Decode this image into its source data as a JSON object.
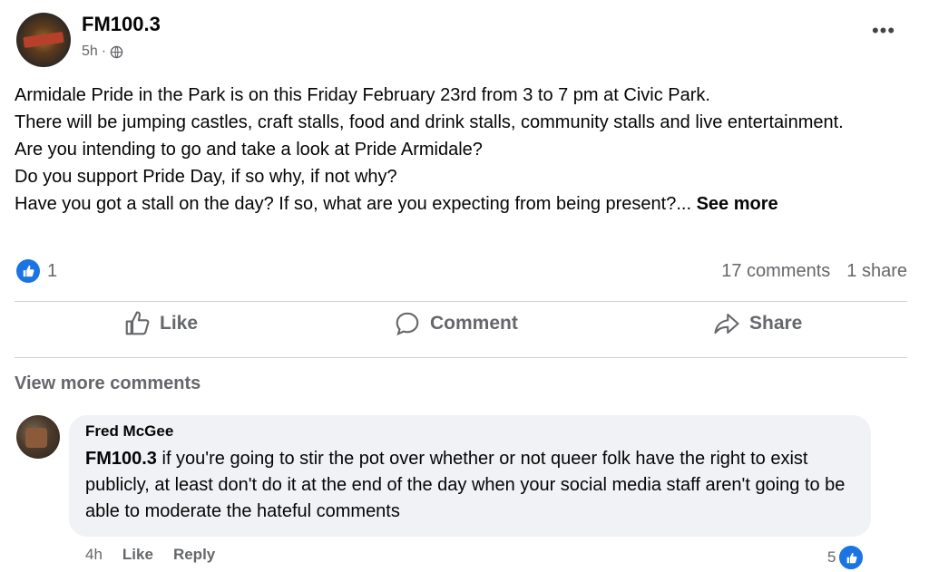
{
  "post": {
    "page_name": "FM100.3",
    "time": "5h",
    "dot": "·",
    "paragraphs": [
      "Armidale Pride in the Park is on this Friday February 23rd from 3 to 7 pm at Civic Park.",
      "There will be jumping castles, craft stalls, food and drink stalls, community stalls and live entertainment.",
      "Are you intending to go and take a look at Pride Armidale?",
      "Do you support Pride Day, if so why, if not why?",
      "Have you got a stall on the day? If so, what are you expecting from being present?..."
    ],
    "see_more": "See more",
    "reaction_count": "1",
    "comments_count": "17 comments",
    "shares_count": "1 share",
    "icons": {
      "more": "more-options-icon",
      "audience": "globe-icon",
      "reaction": "like-reaction-icon"
    }
  },
  "actions": {
    "like": "Like",
    "comment": "Comment",
    "share": "Share"
  },
  "view_more_comments": "View more comments",
  "comment": {
    "author": "Fred McGee",
    "mention": "FM100.3",
    "text": " if you're going to stir the pot over whether or not queer folk have the right to exist publicly, at least don't do it at the end of the day when your social media staff aren't going to be able to moderate the hateful comments",
    "time": "4h",
    "like_label": "Like",
    "reply_label": "Reply",
    "reaction_count": "5"
  },
  "colors": {
    "accent": "#1b74e4",
    "muted": "#65676b",
    "bubble": "#f0f2f5"
  }
}
